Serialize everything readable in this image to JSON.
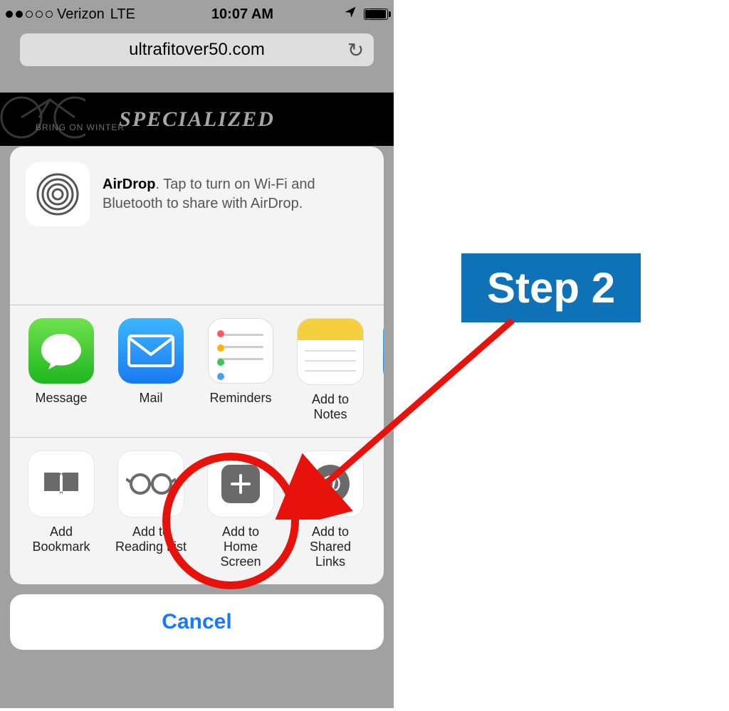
{
  "status": {
    "carrier": "Verizon",
    "network": "LTE",
    "time": "10:07 AM"
  },
  "url_bar": {
    "domain": "ultrafitover50.com"
  },
  "banner": {
    "brand": "SPECIALIZED",
    "tagline": "BRING ON WINTER"
  },
  "airdrop": {
    "title": "AirDrop",
    "desc": ". Tap to turn on Wi-Fi and Bluetooth to share with AirDrop."
  },
  "apps": {
    "message": "Message",
    "mail": "Mail",
    "reminders": "Reminders",
    "notes": "Add to Notes"
  },
  "actions": {
    "bookmark": "Add\nBookmark",
    "readinglist": "Add to\nReading List",
    "homescreen": "Add to\nHome Screen",
    "sharedlinks": "Add to\nShared Links"
  },
  "cancel": "Cancel",
  "annotation": {
    "label": "Step 2"
  }
}
